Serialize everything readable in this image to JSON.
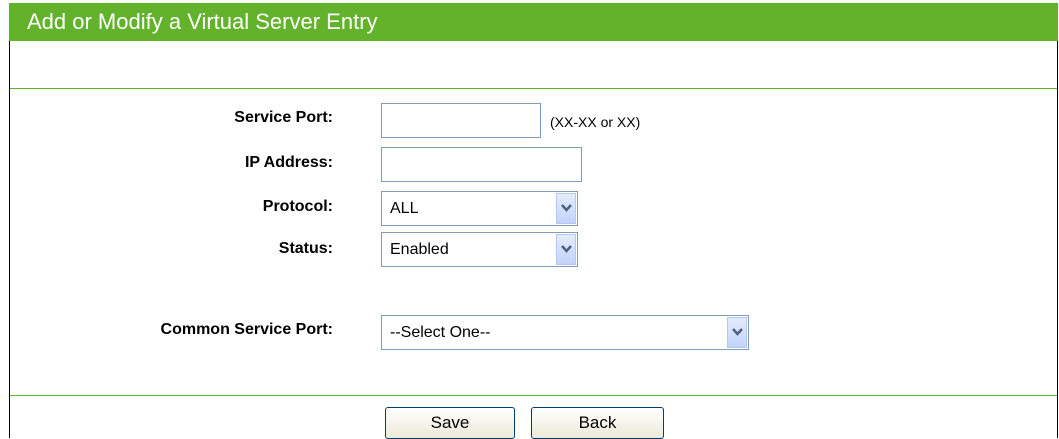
{
  "header": {
    "title": "Add or Modify a Virtual Server Entry"
  },
  "form": {
    "service_port": {
      "label": "Service Port:",
      "value": "",
      "hint": "(XX-XX or XX)"
    },
    "ip_address": {
      "label": "IP Address:",
      "value": ""
    },
    "protocol": {
      "label": "Protocol:",
      "selected": "ALL"
    },
    "status": {
      "label": "Status:",
      "selected": "Enabled"
    },
    "common_service_port": {
      "label": "Common Service Port:",
      "selected": "--Select One--"
    }
  },
  "buttons": {
    "save": "Save",
    "back": "Back"
  },
  "colors": {
    "header": "#63b22b",
    "divider": "#63b22b"
  },
  "icons": {
    "dropdown": "chevron-down-icon"
  }
}
